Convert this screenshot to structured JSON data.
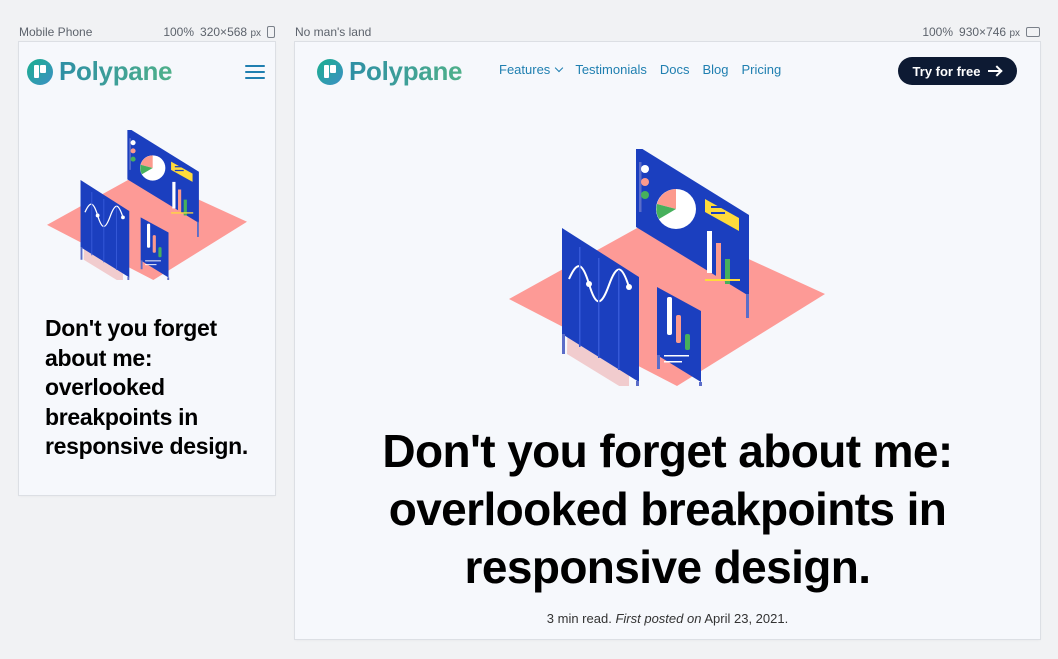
{
  "left_pane": {
    "device_name": "Mobile Phone",
    "zoom": "100%",
    "width": "320",
    "times": "×",
    "height": "568",
    "unit": "px",
    "device_icon": "phone-icon"
  },
  "right_pane": {
    "device_name": "No man's land",
    "zoom": "100%",
    "width": "930",
    "times": "×",
    "height": "746",
    "unit": "px",
    "device_icon": "tablet-icon"
  },
  "site": {
    "logo_text": "Polypane",
    "nav": [
      "Features",
      "Testimonials",
      "Docs",
      "Blog",
      "Pricing"
    ],
    "cta_label": "Try for free",
    "heading": "Don't you forget about me: overlooked breakpoints in responsive design.",
    "byline": {
      "read_time": "3 min read.",
      "first_posted": "First posted",
      "on": "on",
      "date": "April 23, 2021."
    }
  },
  "colors": {
    "brand_blue": "#1f7fb0",
    "brand_green": "#4fb08a",
    "cta_bg": "#0d1a33",
    "illus_floor": "#fd9a96",
    "illus_panel": "#1b3fbf"
  }
}
